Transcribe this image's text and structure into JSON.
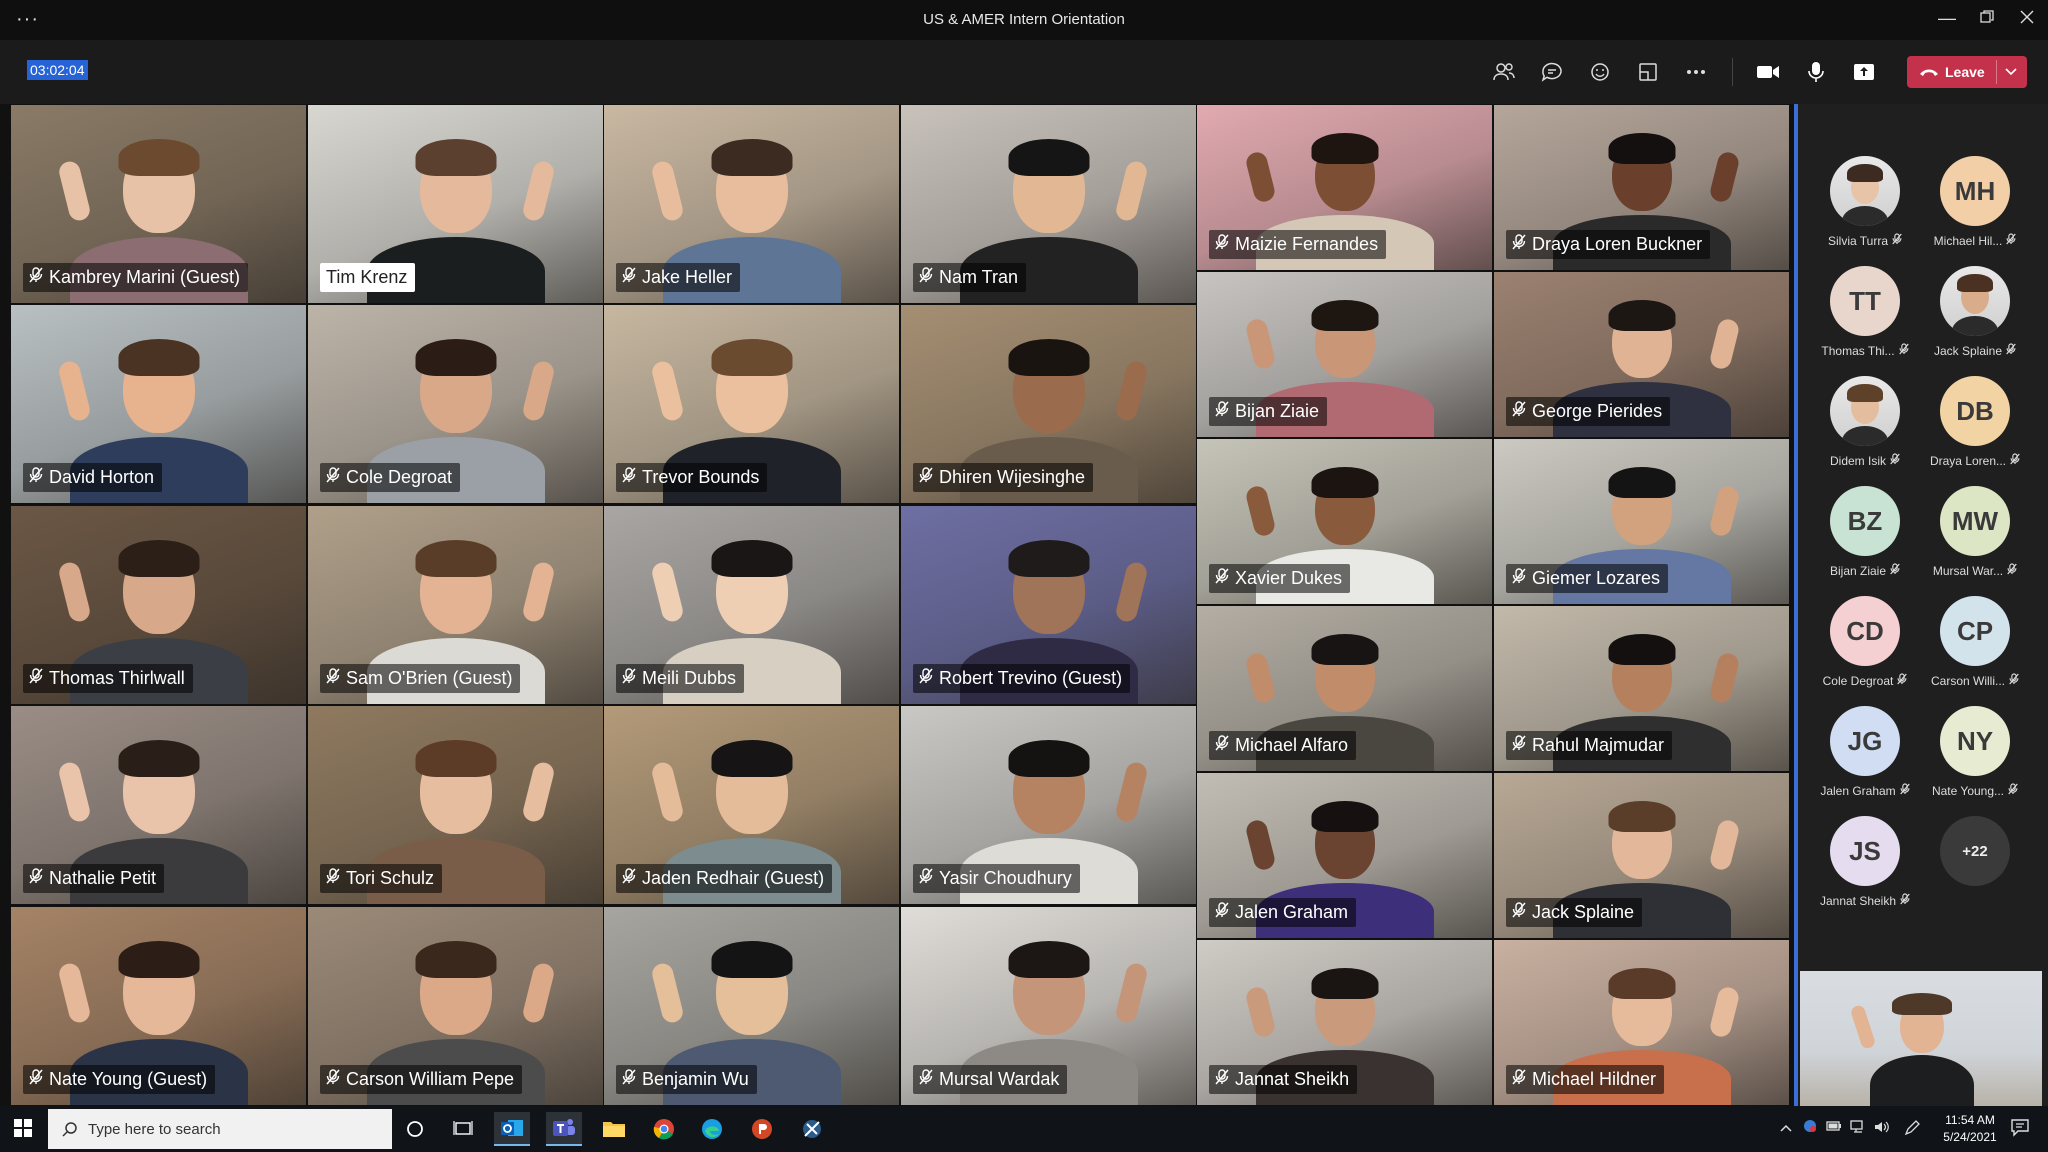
{
  "window": {
    "title": "US & AMER Intern Orientation",
    "menu_dots": "···"
  },
  "toolbar": {
    "timer": "03:02:04",
    "leave_label": "Leave"
  },
  "participants": [
    {
      "name": "Kambrey Marini (Guest)",
      "bg": "#8a7a66",
      "skin": "#e7c2a6",
      "hair": "#6b4a2f",
      "shirt": "#8b6d72"
    },
    {
      "name": "Tim Krenz",
      "bg": "#d8d7d1",
      "skin": "#e5b99b",
      "hair": "#5b4030",
      "shirt": "#1b1e1f",
      "highlight": true
    },
    {
      "name": "Jake Heller",
      "bg": "#c9b8a2",
      "skin": "#e8bd9d",
      "hair": "#3c2b20",
      "shirt": "#5f7596"
    },
    {
      "name": "Nam Tran",
      "bg": "#c8c2bb",
      "skin": "#e2b894",
      "hair": "#151515",
      "shirt": "#222"
    },
    {
      "name": "Maizie Fernandes",
      "bg": "#e1aab0",
      "skin": "#7c4f35",
      "hair": "#1e1410",
      "shirt": "#d5c7b6"
    },
    {
      "name": "Draya Loren Buckner",
      "bg": "#b5a69a",
      "skin": "#6a3f2b",
      "hair": "#141010",
      "shirt": "#2a2a2a"
    },
    {
      "name": "David Horton",
      "bg": "#b9c0c2",
      "skin": "#e7b38f",
      "hair": "#4a3322",
      "shirt": "#2e3d5c"
    },
    {
      "name": "Cole Degroat",
      "bg": "#bdb4a8",
      "skin": "#d9a888",
      "hair": "#2b1d15",
      "shirt": "#9aa0a5"
    },
    {
      "name": "Trevor Bounds",
      "bg": "#c6b7a0",
      "skin": "#eac09f",
      "hair": "#6a4b30",
      "shirt": "#1f2329"
    },
    {
      "name": "Dhiren Wijesinghe",
      "bg": "#a58f73",
      "skin": "#9a6b4d",
      "hair": "#1a1410",
      "shirt": "#6a5c4c"
    },
    {
      "name": "Bijan Ziaie",
      "bg": "#c7c4c1",
      "skin": "#c99777",
      "hair": "#1d1611",
      "shirt": "#b26a72"
    },
    {
      "name": "George Pierides",
      "bg": "#9b8170",
      "skin": "#e0b394",
      "hair": "#1d1714",
      "shirt": "#2f3140"
    },
    {
      "name": "Thomas Thirlwall",
      "bg": "#6b5745",
      "skin": "#d7a88a",
      "hair": "#2b1f18",
      "shirt": "#3b3f45"
    },
    {
      "name": "Sam O'Brien (Guest)",
      "bg": "#b0a08a",
      "skin": "#e3b394",
      "hair": "#5a3d28",
      "shirt": "#dcdad4"
    },
    {
      "name": "Meili Dubbs",
      "bg": "#a9a6a3",
      "skin": "#efcfb4",
      "hair": "#1b1616",
      "shirt": "#d8cfc3"
    },
    {
      "name": "Robert Trevino (Guest)",
      "bg": "#6e6fa3",
      "skin": "#9f7459",
      "hair": "#1f1b1b",
      "shirt": "#2f2b45"
    },
    {
      "name": "Xavier Dukes",
      "bg": "#c6c4b8",
      "skin": "#8a5a3c",
      "hair": "#1b1410",
      "shirt": "#e8e8e5"
    },
    {
      "name": "Giemer Lozares",
      "bg": "#cbc9c1",
      "skin": "#d2a27f",
      "hair": "#141414",
      "shirt": "#6478a3"
    },
    {
      "name": "Nathalie Petit",
      "bg": "#9a8d85",
      "skin": "#e9c4aa",
      "hair": "#2a1e18",
      "shirt": "#3b3a3d"
    },
    {
      "name": "Tori Schulz",
      "bg": "#8f7a60",
      "skin": "#e6bd9f",
      "hair": "#5c3c26",
      "shirt": "#7a5d48"
    },
    {
      "name": "Jaden Redhair (Guest)",
      "bg": "#b39a79",
      "skin": "#e4bc9a",
      "hair": "#161414",
      "shirt": "#7c8c8f"
    },
    {
      "name": "Yasir Choudhury",
      "bg": "#c9c8c4",
      "skin": "#b58362",
      "hair": "#151212",
      "shirt": "#dedcd7"
    },
    {
      "name": "Michael Alfaro",
      "bg": "#b4aea4",
      "skin": "#c08c6a",
      "hair": "#181414",
      "shirt": "#4a4640"
    },
    {
      "name": "Rahul Majmudar",
      "bg": "#c2b9aa",
      "skin": "#b4805d",
      "hair": "#141010",
      "shirt": "#2f2f2f"
    },
    {
      "name": "Nate Young (Guest)",
      "bg": "#a58366",
      "skin": "#e4b898",
      "hair": "#2c1e16",
      "shirt": "#2a3446"
    },
    {
      "name": "Carson William Pepe",
      "bg": "#9c8a78",
      "skin": "#dba987",
      "hair": "#3a281c",
      "shirt": "#4c4c4c"
    },
    {
      "name": "Benjamin Wu",
      "bg": "#a7a59f",
      "skin": "#e5be9a",
      "hair": "#151414",
      "shirt": "#4d5a71"
    },
    {
      "name": "Mursal Wardak",
      "bg": "#e0ddd8",
      "skin": "#c49579",
      "hair": "#1c1715",
      "shirt": "#8d8a86"
    },
    {
      "name": "Jalen Graham",
      "bg": "#c2bdb4",
      "skin": "#6a4430",
      "hair": "#161010",
      "shirt": "#3e2f7a"
    },
    {
      "name": "Jack Splaine",
      "bg": "#b8a895",
      "skin": "#e3b89a",
      "hair": "#5a3e2a",
      "shirt": "#2f2f36"
    },
    {
      "name": "Jannat Sheikh",
      "bg": "#cfcbc5",
      "skin": "#c99a7c",
      "hair": "#1a1412",
      "shirt": "#3a3230"
    },
    {
      "name": "Michael Hildner",
      "bg": "#c9b0a0",
      "skin": "#e6bb9b",
      "hair": "#5a3b2a",
      "shirt": "#c8704c"
    }
  ],
  "roster": [
    {
      "name": "Silvia Turra",
      "initials": "",
      "color": "#ffffff",
      "photo": true,
      "skin": "#e7c3a8",
      "hair": "#3d2a20"
    },
    {
      "name": "Michael Hil...",
      "initials": "MH",
      "color": "#f3cfa8"
    },
    {
      "name": "Thomas Thi...",
      "initials": "TT",
      "color": "#e8d6cd"
    },
    {
      "name": "Jack Splaine",
      "initials": "",
      "color": "#ffffff",
      "photo": true,
      "skin": "#d9ad8c",
      "hair": "#4a3122"
    },
    {
      "name": "Didem Isik",
      "initials": "",
      "color": "#ffffff",
      "photo": true,
      "skin": "#e4bd9e",
      "hair": "#5e4129"
    },
    {
      "name": "Draya Loren...",
      "initials": "DB",
      "color": "#f2d3a3"
    },
    {
      "name": "Bijan Ziaie",
      "initials": "BZ",
      "color": "#c8e3d3"
    },
    {
      "name": "Mursal War...",
      "initials": "MW",
      "color": "#dce6c4"
    },
    {
      "name": "Cole Degroat",
      "initials": "CD",
      "color": "#f5d0d3"
    },
    {
      "name": "Carson Willi...",
      "initials": "CP",
      "color": "#d3e3ec"
    },
    {
      "name": "Jalen Graham",
      "initials": "JG",
      "color": "#d0ddf2"
    },
    {
      "name": "Nate Young...",
      "initials": "NY",
      "color": "#e6ebd2"
    },
    {
      "name": "Jannat Sheikh",
      "initials": "JS",
      "color": "#e5dcef"
    }
  ],
  "overflow_count": "+22",
  "taskbar": {
    "search_placeholder": "Type here to search",
    "time": "11:54 AM",
    "date": "5/24/2021"
  },
  "colors": {
    "accent": "#3b6fd8",
    "leave": "#c4314b",
    "timer_bg": "#2563d6"
  }
}
